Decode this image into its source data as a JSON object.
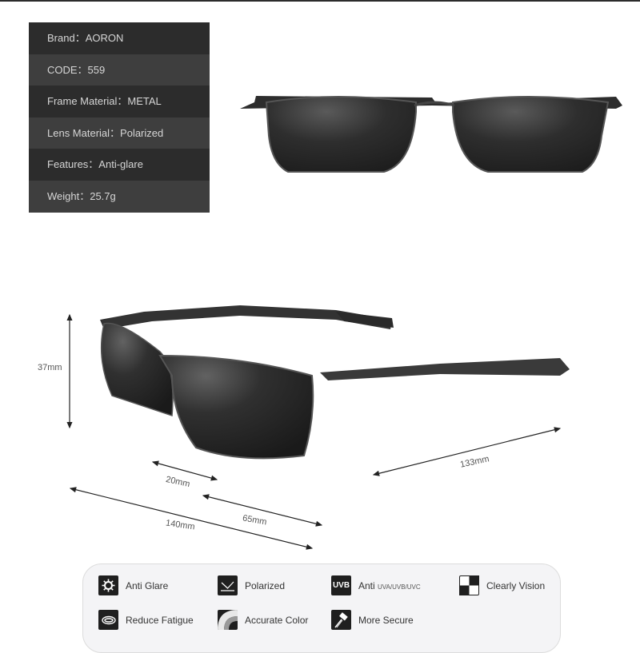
{
  "specs": [
    {
      "label": "Brand",
      "value": "AORON"
    },
    {
      "label": "CODE",
      "value": "559"
    },
    {
      "label": "Frame Material",
      "value": "METAL"
    },
    {
      "label": "Lens Material",
      "value": "Polarized"
    },
    {
      "label": "Features",
      "value": "Anti-glare"
    },
    {
      "label": "Weight",
      "value": "25.7g"
    }
  ],
  "spec_text": [
    "Brand：AORON",
    "CODE：559",
    "Frame Material：METAL",
    "Lens Material：Polarized",
    "Features：Anti-glare",
    "Weight：25.7g"
  ],
  "dimensions": {
    "lens_height": "37mm",
    "bridge": "20mm",
    "lens_width": "65mm",
    "frame_width": "140mm",
    "temple_length": "133mm"
  },
  "features": [
    {
      "icon": "sun-icon",
      "label": "Anti Glare"
    },
    {
      "icon": "polarized-icon",
      "label": "Polarized"
    },
    {
      "icon": "uvb-icon",
      "icon_text": "UVB",
      "label": "Anti",
      "sublabel": "UVA/UVB/UVC"
    },
    {
      "icon": "checker-icon",
      "label": "Clearly Vision"
    },
    {
      "icon": "eye-icon",
      "label": "Reduce Fatigue"
    },
    {
      "icon": "color-arc-icon",
      "label": "Accurate Color"
    },
    {
      "icon": "hammer-icon",
      "label": "More Secure"
    }
  ],
  "colors": {
    "panel_dark": "#2c2c2c",
    "panel_light": "#3e3e3e",
    "lens": "#2a2a2a"
  }
}
